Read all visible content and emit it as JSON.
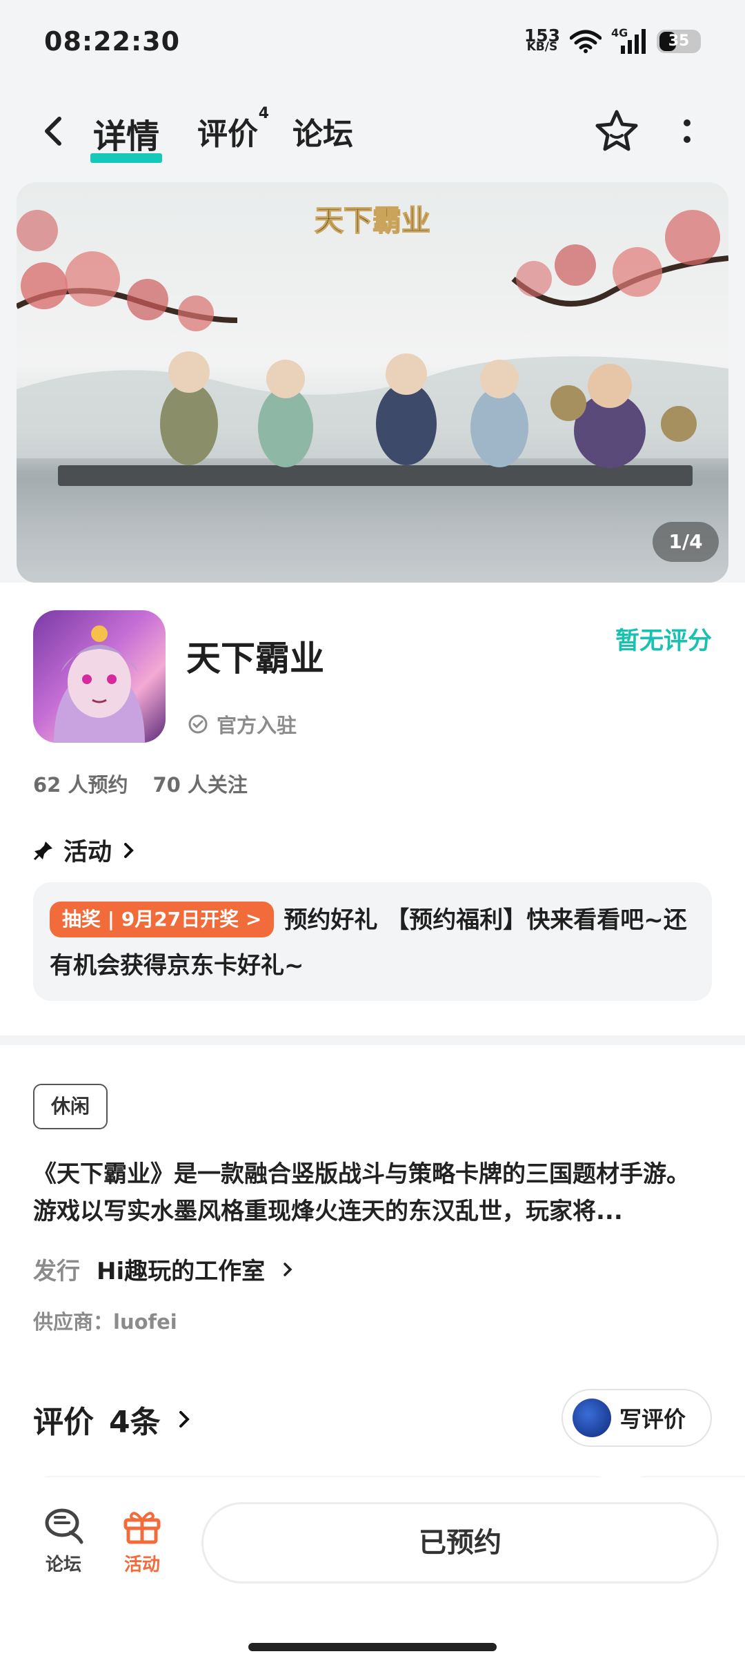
{
  "status_bar": {
    "time": "08:22:30",
    "net_speed_value": "153",
    "net_speed_unit": "KB/S",
    "network_type": "4G",
    "battery": "35"
  },
  "nav": {
    "tab_detail": "详情",
    "tab_review": "评价",
    "tab_review_badge": "4",
    "tab_forum": "论坛"
  },
  "banner": {
    "logo_text": "天下霸业",
    "pager": "1/4"
  },
  "app": {
    "name": "天下霸业",
    "rating_text": "暂无评分",
    "official_label": "官方入驻",
    "reservations": "62 人预约",
    "followers": "70 人关注"
  },
  "activity": {
    "title": "活动",
    "tag": "抽奖 | 9月27日开奖 >",
    "text": "预约好礼 【预约福利】快来看看吧~还有机会获得京东卡好礼~"
  },
  "info": {
    "genre_tag": "休闲",
    "description": "《天下霸业》是一款融合竖版战斗与策略卡牌的三国题材手游。游戏以写实水墨风格重现烽火连天的东汉乱世，玩家将...",
    "publisher_label": "发行",
    "publisher_name": "Hi趣玩的工作室",
    "supplier": "供应商：luofei"
  },
  "reviews": {
    "title": "评价",
    "count": "4条",
    "write_button": "写评价"
  },
  "bottom_bar": {
    "forum_label": "论坛",
    "activity_label": "活动",
    "reserved_button": "已预约"
  },
  "colors": {
    "accent_teal": "#15c8b9",
    "accent_orange": "#f26b3a"
  }
}
